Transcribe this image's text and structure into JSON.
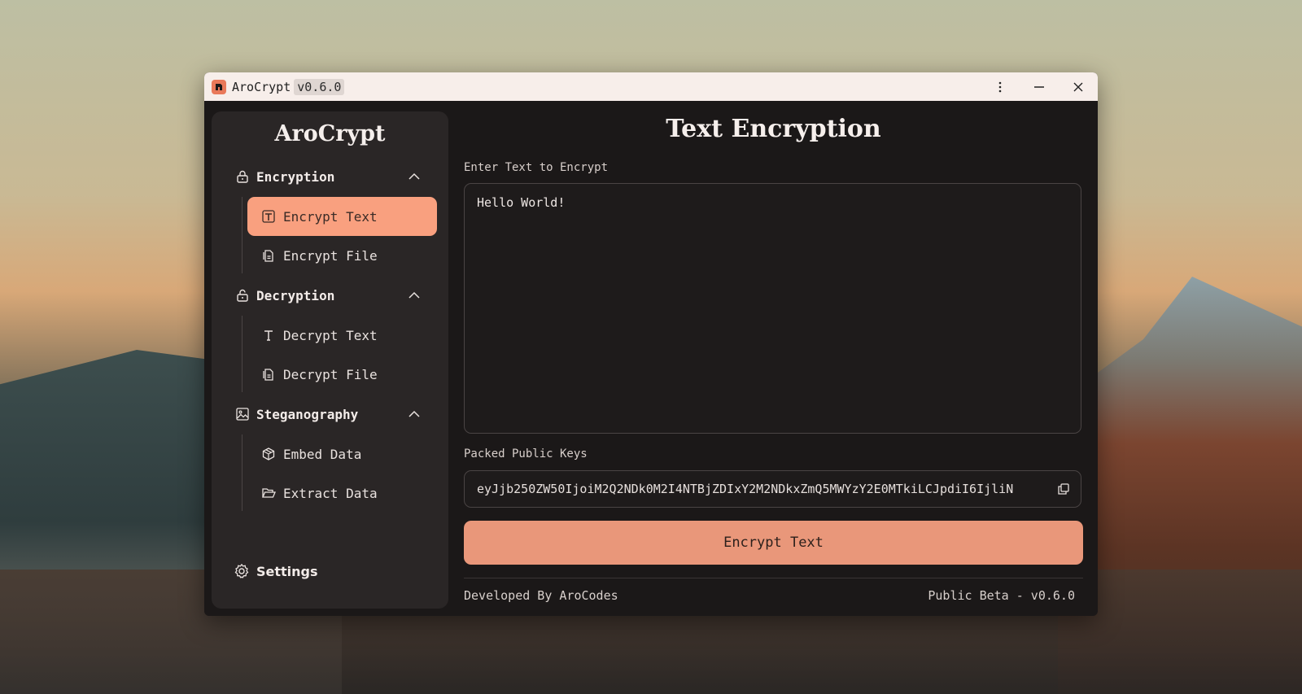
{
  "window": {
    "app_name": "AroCrypt",
    "version_badge": "v0.6.0"
  },
  "sidebar": {
    "brand": "AroCrypt",
    "sections": [
      {
        "label": "Encryption",
        "items": [
          {
            "label": "Encrypt Text",
            "active": true
          },
          {
            "label": "Encrypt File",
            "active": false
          }
        ]
      },
      {
        "label": "Decryption",
        "items": [
          {
            "label": "Decrypt Text",
            "active": false
          },
          {
            "label": "Decrypt File",
            "active": false
          }
        ]
      },
      {
        "label": "Steganography",
        "items": [
          {
            "label": "Embed Data",
            "active": false
          },
          {
            "label": "Extract Data",
            "active": false
          }
        ]
      }
    ],
    "settings_label": "Settings"
  },
  "main": {
    "title": "Text Encryption",
    "input_label": "Enter Text to Encrypt",
    "input_value": "Hello World!",
    "keys_label": "Packed Public Keys",
    "keys_value": "eyJjb250ZW50IjoiM2Q2NDk0M2I4NTBjZDIxY2M2NDkxZmQ5MWYzY2E0MTkiLCJpdiI6IjliN",
    "encrypt_button": "Encrypt Text"
  },
  "footer": {
    "left": "Developed By AroCodes",
    "right": "Public Beta - v0.6.0"
  },
  "colors": {
    "accent": "#f9a07f",
    "button": "#e9977a",
    "window_bg": "#1b1818",
    "sidebar_bg": "#2a2626",
    "titlebar_bg": "#f7eeea"
  }
}
